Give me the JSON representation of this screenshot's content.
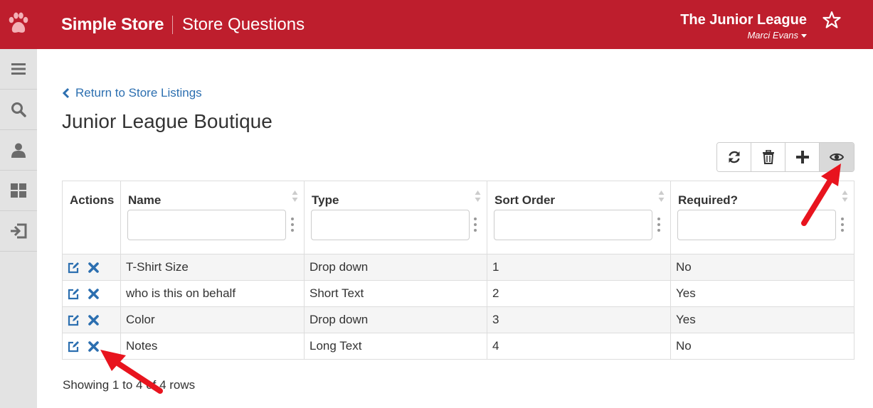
{
  "header": {
    "app_title": "Simple Store",
    "page_name": "Store Questions",
    "org_name": "The Junior League",
    "user_name": "Marci Evans"
  },
  "sidebar": {
    "items": [
      {
        "icon": "menu-icon"
      },
      {
        "icon": "search-icon"
      },
      {
        "icon": "user-icon"
      },
      {
        "icon": "dashboard-icon"
      },
      {
        "icon": "sign-out-icon"
      }
    ]
  },
  "main": {
    "back_link": "Return to Store Listings",
    "title": "Junior League Boutique",
    "toolbar": [
      "refresh-icon",
      "trash-icon",
      "plus-icon",
      "eye-icon"
    ],
    "table": {
      "columns": [
        "Actions",
        "Name",
        "Type",
        "Sort Order",
        "Required?"
      ],
      "rows": [
        {
          "name": "T-Shirt Size",
          "type": "Drop down",
          "sort": "1",
          "required": "No"
        },
        {
          "name": "who is this on behalf",
          "type": "Short Text",
          "sort": "2",
          "required": "Yes"
        },
        {
          "name": "Color",
          "type": "Drop down",
          "sort": "3",
          "required": "Yes"
        },
        {
          "name": "Notes",
          "type": "Long Text",
          "sort": "4",
          "required": "No"
        }
      ]
    },
    "footer": "Showing 1 to 4 of 4 rows"
  },
  "colors": {
    "brand": "#be1e2d",
    "link": "#2c6fb0",
    "annotation_arrow": "#e8141e"
  }
}
